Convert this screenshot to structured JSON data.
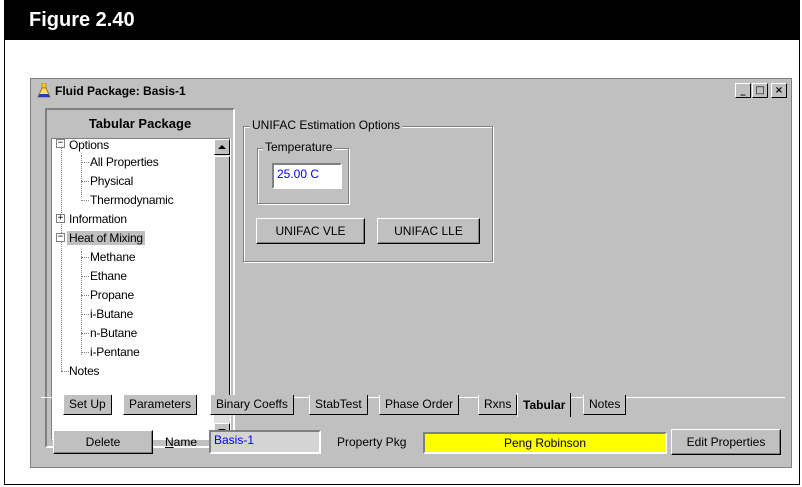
{
  "figure": {
    "title": "Figure 2.40"
  },
  "window": {
    "title": "Fluid Package: Basis-1",
    "controls": {
      "minimize": "_",
      "maximize": "□",
      "close": "×"
    }
  },
  "tree": {
    "title": "Tabular Package",
    "items": [
      {
        "label": "Options",
        "expander": "−"
      },
      {
        "label": "All Properties"
      },
      {
        "label": "Physical"
      },
      {
        "label": "Thermodynamic"
      },
      {
        "label": "Information",
        "expander": "+"
      },
      {
        "label": "Heat of Mixing",
        "expander": "−",
        "selected": true
      },
      {
        "label": "Methane"
      },
      {
        "label": "Ethane"
      },
      {
        "label": "Propane"
      },
      {
        "label": "i-Butane"
      },
      {
        "label": "n-Butane"
      },
      {
        "label": "i-Pentane"
      },
      {
        "label": "Notes"
      }
    ]
  },
  "unifac": {
    "group_label": "UNIFAC Estimation Options",
    "temperature_label": "Temperature",
    "temperature_value": "25.00 C",
    "vle_button": "UNIFAC VLE",
    "lle_button": "UNIFAC LLE"
  },
  "tabs": [
    {
      "label": "Set Up"
    },
    {
      "label": "Parameters"
    },
    {
      "label": "Binary Coeffs"
    },
    {
      "label": "StabTest"
    },
    {
      "label": "Phase Order"
    },
    {
      "label": "Rxns"
    },
    {
      "label": "Tabular",
      "active": true
    },
    {
      "label": "Notes"
    }
  ],
  "bottom": {
    "delete_button": "Delete",
    "name_label_underline": "N",
    "name_label_rest": "ame",
    "name_value": "Basis-1",
    "property_pkg_label": "Property Pkg",
    "property_pkg_value": "Peng Robinson",
    "edit_properties_button": "Edit Properties"
  },
  "colors": {
    "window_bg": "#c0c0c0",
    "pkg_highlight": "#ffff00",
    "value_text": "#0000ff"
  }
}
